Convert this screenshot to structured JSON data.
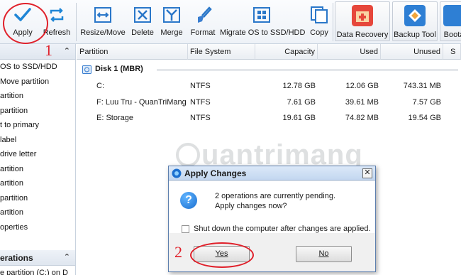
{
  "toolbar": {
    "buttons": [
      {
        "label": "Apply"
      },
      {
        "label": "Refresh"
      },
      {
        "label": "Resize/Move"
      },
      {
        "label": "Delete"
      },
      {
        "label": "Merge"
      },
      {
        "label": "Format"
      },
      {
        "label": "Migrate OS to SSD/HDD"
      },
      {
        "label": "Copy"
      },
      {
        "label": "Data Recovery"
      },
      {
        "label": "Backup Tool"
      },
      {
        "label": "Boota"
      }
    ]
  },
  "sidebar": {
    "operations_items": [
      "OS to SSD/HDD",
      "Move partition",
      "artition",
      "partition",
      "t to primary",
      "label",
      "drive letter",
      "artition",
      "artition",
      "partition",
      "artition",
      "operties"
    ],
    "pending_header": "erations",
    "pending_item": "e partition (C:) on D"
  },
  "table": {
    "columns": [
      "Partition",
      "File System",
      "Capacity",
      "Used",
      "Unused",
      "S"
    ],
    "disk_label": "Disk 1 (MBR)",
    "rows": [
      {
        "partition": "C:",
        "fs": "NTFS",
        "capacity": "12.78 GB",
        "used": "12.06 GB",
        "unused": "743.31 MB"
      },
      {
        "partition": "F: Luu Tru - QuanTriMang",
        "fs": "NTFS",
        "capacity": "7.61 GB",
        "used": "39.61 MB",
        "unused": "7.57 GB"
      },
      {
        "partition": "E: Storage",
        "fs": "NTFS",
        "capacity": "19.61 GB",
        "used": "74.82 MB",
        "unused": "19.54 GB"
      }
    ]
  },
  "watermark": "uantrimang",
  "dialog": {
    "title": "Apply Changes",
    "close_glyph": "✕",
    "icon_glyph": "?",
    "message_line1": "2 operations are currently pending.",
    "message_line2": "Apply changes now?",
    "checkbox_label": "Shut down the computer after changes are applied.",
    "yes_label": "Yes",
    "no_label": "No"
  },
  "annotations": {
    "step1": "1",
    "step2": "2"
  },
  "colors": {
    "accent_blue": "#1c6fcf",
    "annotation_red": "#e0202a",
    "data_recovery": "#e6473b",
    "backup_tool": "#2e7fd4"
  }
}
